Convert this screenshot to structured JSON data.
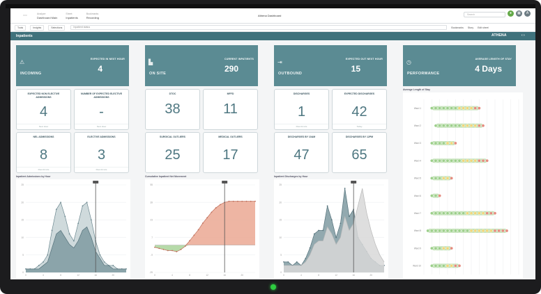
{
  "appbar": {
    "crumbs": [
      {
        "key": "Analyze",
        "value": "Dashboard Main"
      },
      {
        "key": "Sheet",
        "value": "Inpatients"
      },
      {
        "key": "Bookmarks",
        "value": "Recording"
      }
    ],
    "title": "Athena Dashboard",
    "search_placeholder": "Search",
    "user_initial": "A"
  },
  "toolbar": {
    "items": [
      "Tools",
      "Insights",
      "Selections"
    ],
    "field": "Inpatient status",
    "right_items": [
      "Bookmarks",
      "Story",
      "Edit sheet"
    ]
  },
  "sheet": {
    "title": "Inpatients",
    "logo": "ATHENA",
    "nav": "‹ ›"
  },
  "kpis": [
    {
      "label": "INCOMING",
      "caption": "EXPECTED IN NEXT HOUR",
      "value": "4",
      "icon": "⚠",
      "icon_name": "alert-icon"
    },
    {
      "label": "ON SITE",
      "caption": "CURRENT INPATIENTS",
      "value": "290",
      "icon": "▙",
      "icon_name": "bed-icon"
    },
    {
      "label": "OUTBOUND",
      "caption": "EXPECTED OUT NEXT HOUR",
      "value": "15",
      "icon": "⇥",
      "icon_name": "exit-icon"
    },
    {
      "label": "PERFORMANCE",
      "caption": "AVERAGE LENGTH OF STAY",
      "value": "4 Days",
      "icon": "◷",
      "icon_name": "gauge-icon"
    }
  ],
  "stats": [
    {
      "title": "EXPECTED NON ELECTIVE ADMISSIONS",
      "value": "4",
      "sub": "Next Hour"
    },
    {
      "title": "NUMBER OF EXPECTED ELECTIVE ADMISSIONS",
      "value": "-",
      "sub": "Next Hour"
    },
    {
      "title": "NEL ADMISSIONS",
      "value": "8",
      "sub": "Past 24 Hrs"
    },
    {
      "title": "ELECTIVE ADMISSIONS",
      "value": "3",
      "sub": "Past 24 Hrs"
    },
    {
      "title": "DTOC",
      "value": "38",
      "sub": ""
    },
    {
      "title": "MFFD",
      "value": "11",
      "sub": ""
    },
    {
      "title": "SURGICAL OUTLIERS",
      "value": "25",
      "sub": ""
    },
    {
      "title": "MEDICAL OUTLIERS",
      "value": "17",
      "sub": ""
    },
    {
      "title": "DISCHARGES",
      "value": "1",
      "sub": "Past 24 Hrs"
    },
    {
      "title": "EXPECTED DISCHARGES",
      "value": "42",
      "sub": "Today"
    },
    {
      "title": "DISCHARGES BY 10AM",
      "value": "47",
      "sub": ""
    },
    {
      "title": "DISCHARGES BY 12PM",
      "value": "65",
      "sub": ""
    }
  ],
  "colors": {
    "kpi_tile": "#5b8b93",
    "stat_value": "#4e7781",
    "area_dark": "#7f9aa1",
    "area_light": "#c7d3d6",
    "area_grey": "#d8d8d8",
    "net_positive": "#eba893",
    "net_negative": "#a9d49a",
    "los_green": "#9ccf8a",
    "los_yellow": "#f0d67a",
    "los_red": "#e58b7e"
  },
  "chart_data": [
    {
      "type": "area",
      "title": "Inpatient Admissions by Hour",
      "x": [
        0,
        1,
        2,
        3,
        4,
        5,
        6,
        7,
        8,
        9,
        10,
        11,
        12,
        13,
        14,
        15,
        16,
        17,
        18,
        19,
        20,
        21,
        22,
        23
      ],
      "series": [
        {
          "values": [
            1,
            1,
            1,
            2,
            3,
            5,
            12,
            18,
            20,
            16,
            11,
            9,
            14,
            19,
            20,
            15,
            9,
            5,
            3,
            2,
            2,
            1,
            1,
            1
          ]
        },
        {
          "values": [
            1,
            1,
            1,
            1,
            2,
            3,
            7,
            11,
            12,
            10,
            8,
            7,
            9,
            12,
            13,
            10,
            6,
            4,
            2,
            2,
            1,
            1,
            1,
            1
          ]
        }
      ],
      "ylim": [
        0,
        25
      ],
      "marker_hour": 16
    },
    {
      "type": "area",
      "title": "Cumulative Inpatient Net Movement",
      "x": [
        0,
        1,
        2,
        3,
        4,
        5,
        6,
        7,
        8,
        9,
        10,
        11,
        12,
        13,
        14,
        15,
        16,
        17,
        18,
        19,
        20,
        21,
        22,
        23
      ],
      "series": [
        {
          "values": [
            -2,
            -3,
            -4,
            -5,
            -5,
            -6,
            -4,
            -1,
            4,
            9,
            14,
            20,
            25,
            30,
            34,
            37,
            39,
            40,
            40,
            40,
            40,
            40,
            40,
            40
          ]
        }
      ],
      "ylim": [
        -25,
        55
      ],
      "marker_hour": 16
    },
    {
      "type": "area",
      "title": "Inpatient Discharges by Hour",
      "x": [
        0,
        1,
        2,
        3,
        4,
        5,
        6,
        7,
        8,
        9,
        10,
        11,
        12,
        13,
        14,
        15,
        16,
        17,
        18,
        19,
        20,
        21,
        22,
        23
      ],
      "series": [
        {
          "values": [
            3,
            3,
            2,
            3,
            2,
            4,
            7,
            11,
            12,
            12,
            19,
            15,
            10,
            14,
            24,
            16,
            18,
            10,
            8,
            6,
            4,
            3,
            2,
            2
          ]
        },
        {
          "values": [
            2,
            2,
            2,
            2,
            2,
            3,
            5,
            8,
            9,
            9,
            13,
            11,
            8,
            10,
            16,
            12,
            14,
            19,
            24,
            17,
            12,
            8,
            5,
            3
          ]
        }
      ],
      "ylim": [
        0,
        25
      ],
      "marker_hour": 16
    },
    {
      "type": "scatter",
      "title": "Average Length of Stay",
      "categories": [
        "Ward 1",
        "Ward 2",
        "Ward 3",
        "Ward 4",
        "Ward 5",
        "Ward 6",
        "Ward 7",
        "Ward 8",
        "Ward 9",
        "Ward 10"
      ],
      "ranges": [
        [
          2,
          14
        ],
        [
          3,
          15
        ],
        [
          2,
          8
        ],
        [
          2,
          16
        ],
        [
          2,
          7
        ],
        [
          2,
          4
        ],
        [
          2,
          18
        ],
        [
          1,
          21
        ],
        [
          2,
          7
        ],
        [
          2,
          9
        ]
      ]
    }
  ]
}
